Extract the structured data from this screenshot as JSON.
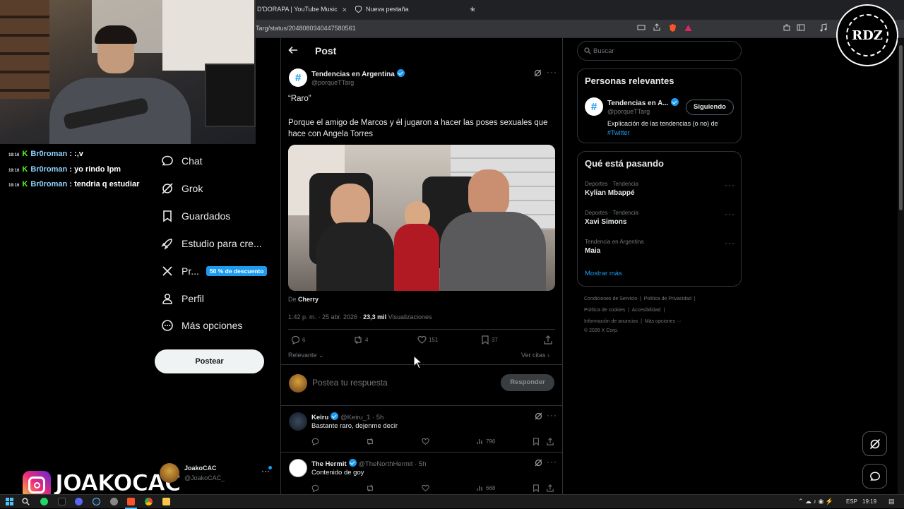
{
  "browser": {
    "tabs": [
      {
        "label": "D'DORAPA | YouTube Music"
      },
      {
        "label": "Nueva pestaña"
      }
    ],
    "new_tab": "+",
    "url": "Targ/status/2048080340447580561"
  },
  "stream": {
    "chat": [
      {
        "time": "19:16",
        "user": "Br0roman",
        "text": ": :,v"
      },
      {
        "time": "19:16",
        "user": "Br0roman",
        "text": ": yo rindo lpm"
      },
      {
        "time": "19:16",
        "user": "Br0roman",
        "text": ": tendria q estudiar"
      }
    ],
    "channel_name": "JOAKOCAC",
    "logo_text": "RDZ"
  },
  "left_nav": {
    "items": [
      {
        "label": "Chat",
        "icon": "chat-icon"
      },
      {
        "label": "Grok",
        "icon": "grok-icon"
      },
      {
        "label": "Guardados",
        "icon": "bookmark-icon"
      },
      {
        "label": "Estudio para cre...",
        "icon": "rocket-icon"
      },
      {
        "label": "Pr...",
        "icon": "x-logo-icon",
        "badge": "50 % de descuento"
      },
      {
        "label": "Perfil",
        "icon": "person-icon"
      },
      {
        "label": "Más opciones",
        "icon": "more-circle-icon"
      }
    ],
    "post_button": "Postear",
    "account": {
      "name": "JoakoCAC",
      "handle": "@JoakoCAC_"
    }
  },
  "post": {
    "header_title": "Post",
    "author_name": "Tendencias en Argentina",
    "author_handle": "@porqueTTarg",
    "text_line1": "“Raro”",
    "text_line2": "Porque el amigo de Marcos y él jugaron a hacer las poses sexuales que hace con Angela Torres",
    "source_prefix": "De",
    "source_name": "Cherry",
    "timestamp": "1:42 p. m. · 25 abr. 2026 ·",
    "views_count": "23,3 mil",
    "views_label": "Visualizaciones",
    "stats": {
      "replies": "6",
      "reposts": "4",
      "likes": "151",
      "bookmarks": "37"
    },
    "sort_label": "Relevante",
    "quotes_label": "Ver citas",
    "reply_placeholder": "Postea tu respuesta",
    "reply_button": "Responder"
  },
  "replies": [
    {
      "name": "Keiru",
      "handle": "@Keiru_1 · 5h",
      "text": "Bastante raro, dejenme decir",
      "views": "796"
    },
    {
      "name": "The Hermit",
      "handle": "@TheNorthHermit · 5h",
      "text": "Contenido de goy",
      "views": "668"
    }
  ],
  "right": {
    "search_placeholder": "Buscar",
    "relevant_title": "Personas relevantes",
    "relevant_person": {
      "name": "Tendencias en A...",
      "handle": "@porqueTTarg",
      "follow_label": "Siguiendo",
      "bio": "Explicación de las tendencias (o no) de",
      "bio_link": "#Twitter"
    },
    "trends_title": "Qué está pasando",
    "trends": [
      {
        "meta": "Deportes · Tendencia",
        "name": "Kylian Mbappé"
      },
      {
        "meta": "Deportes · Tendencia",
        "name": "Xavi Simons"
      },
      {
        "meta": "Tendencia en Argentina",
        "name": "Maia"
      }
    ],
    "show_more": "Mostrar más",
    "footer_links": [
      "Condiciones de Servicio",
      "Política de Privacidad",
      "Política de cookies",
      "Accesibilidad",
      "Información de anuncios",
      "Más opciones ···"
    ],
    "copyright": "© 2026 X Corp."
  },
  "taskbar": {
    "lang": "ESP",
    "time": "19:19"
  },
  "colors": {
    "accent": "#1d9bf0",
    "background": "#000000",
    "text": "#e7e9ea",
    "muted": "#71767b",
    "kick_green": "#53fc18"
  }
}
